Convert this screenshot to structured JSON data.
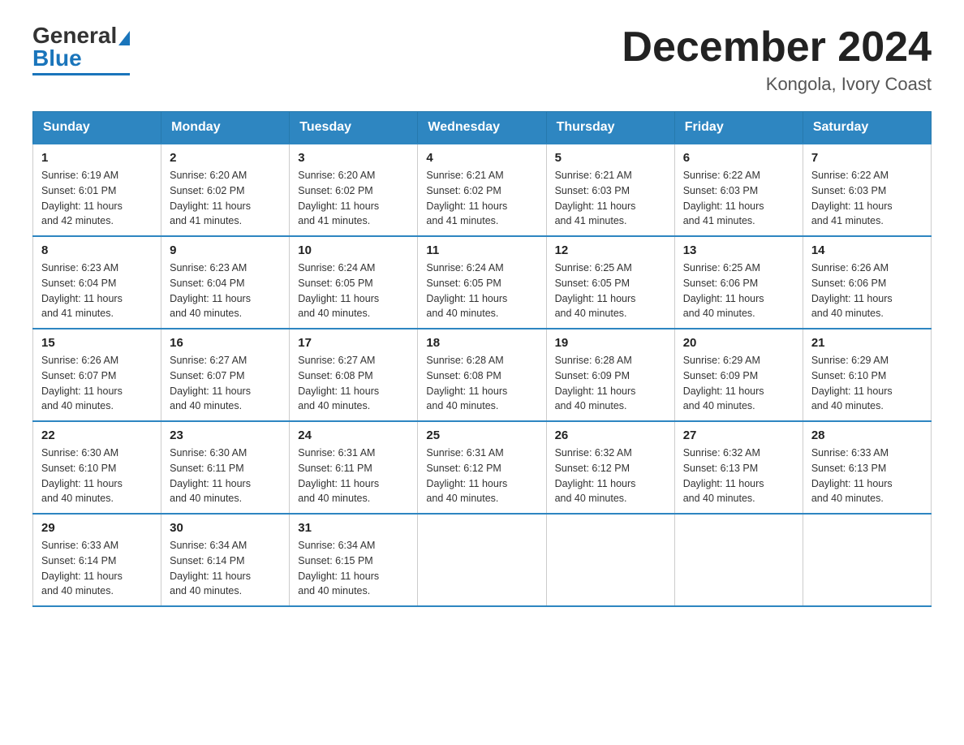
{
  "header": {
    "title": "December 2024",
    "location": "Kongola, Ivory Coast",
    "logo_general": "General",
    "logo_blue": "Blue"
  },
  "days_header": [
    "Sunday",
    "Monday",
    "Tuesday",
    "Wednesday",
    "Thursday",
    "Friday",
    "Saturday"
  ],
  "weeks": [
    [
      {
        "day": "1",
        "sunrise": "6:19 AM",
        "sunset": "6:01 PM",
        "daylight": "11 hours and 42 minutes."
      },
      {
        "day": "2",
        "sunrise": "6:20 AM",
        "sunset": "6:02 PM",
        "daylight": "11 hours and 41 minutes."
      },
      {
        "day": "3",
        "sunrise": "6:20 AM",
        "sunset": "6:02 PM",
        "daylight": "11 hours and 41 minutes."
      },
      {
        "day": "4",
        "sunrise": "6:21 AM",
        "sunset": "6:02 PM",
        "daylight": "11 hours and 41 minutes."
      },
      {
        "day": "5",
        "sunrise": "6:21 AM",
        "sunset": "6:03 PM",
        "daylight": "11 hours and 41 minutes."
      },
      {
        "day": "6",
        "sunrise": "6:22 AM",
        "sunset": "6:03 PM",
        "daylight": "11 hours and 41 minutes."
      },
      {
        "day": "7",
        "sunrise": "6:22 AM",
        "sunset": "6:03 PM",
        "daylight": "11 hours and 41 minutes."
      }
    ],
    [
      {
        "day": "8",
        "sunrise": "6:23 AM",
        "sunset": "6:04 PM",
        "daylight": "11 hours and 41 minutes."
      },
      {
        "day": "9",
        "sunrise": "6:23 AM",
        "sunset": "6:04 PM",
        "daylight": "11 hours and 40 minutes."
      },
      {
        "day": "10",
        "sunrise": "6:24 AM",
        "sunset": "6:05 PM",
        "daylight": "11 hours and 40 minutes."
      },
      {
        "day": "11",
        "sunrise": "6:24 AM",
        "sunset": "6:05 PM",
        "daylight": "11 hours and 40 minutes."
      },
      {
        "day": "12",
        "sunrise": "6:25 AM",
        "sunset": "6:05 PM",
        "daylight": "11 hours and 40 minutes."
      },
      {
        "day": "13",
        "sunrise": "6:25 AM",
        "sunset": "6:06 PM",
        "daylight": "11 hours and 40 minutes."
      },
      {
        "day": "14",
        "sunrise": "6:26 AM",
        "sunset": "6:06 PM",
        "daylight": "11 hours and 40 minutes."
      }
    ],
    [
      {
        "day": "15",
        "sunrise": "6:26 AM",
        "sunset": "6:07 PM",
        "daylight": "11 hours and 40 minutes."
      },
      {
        "day": "16",
        "sunrise": "6:27 AM",
        "sunset": "6:07 PM",
        "daylight": "11 hours and 40 minutes."
      },
      {
        "day": "17",
        "sunrise": "6:27 AM",
        "sunset": "6:08 PM",
        "daylight": "11 hours and 40 minutes."
      },
      {
        "day": "18",
        "sunrise": "6:28 AM",
        "sunset": "6:08 PM",
        "daylight": "11 hours and 40 minutes."
      },
      {
        "day": "19",
        "sunrise": "6:28 AM",
        "sunset": "6:09 PM",
        "daylight": "11 hours and 40 minutes."
      },
      {
        "day": "20",
        "sunrise": "6:29 AM",
        "sunset": "6:09 PM",
        "daylight": "11 hours and 40 minutes."
      },
      {
        "day": "21",
        "sunrise": "6:29 AM",
        "sunset": "6:10 PM",
        "daylight": "11 hours and 40 minutes."
      }
    ],
    [
      {
        "day": "22",
        "sunrise": "6:30 AM",
        "sunset": "6:10 PM",
        "daylight": "11 hours and 40 minutes."
      },
      {
        "day": "23",
        "sunrise": "6:30 AM",
        "sunset": "6:11 PM",
        "daylight": "11 hours and 40 minutes."
      },
      {
        "day": "24",
        "sunrise": "6:31 AM",
        "sunset": "6:11 PM",
        "daylight": "11 hours and 40 minutes."
      },
      {
        "day": "25",
        "sunrise": "6:31 AM",
        "sunset": "6:12 PM",
        "daylight": "11 hours and 40 minutes."
      },
      {
        "day": "26",
        "sunrise": "6:32 AM",
        "sunset": "6:12 PM",
        "daylight": "11 hours and 40 minutes."
      },
      {
        "day": "27",
        "sunrise": "6:32 AM",
        "sunset": "6:13 PM",
        "daylight": "11 hours and 40 minutes."
      },
      {
        "day": "28",
        "sunrise": "6:33 AM",
        "sunset": "6:13 PM",
        "daylight": "11 hours and 40 minutes."
      }
    ],
    [
      {
        "day": "29",
        "sunrise": "6:33 AM",
        "sunset": "6:14 PM",
        "daylight": "11 hours and 40 minutes."
      },
      {
        "day": "30",
        "sunrise": "6:34 AM",
        "sunset": "6:14 PM",
        "daylight": "11 hours and 40 minutes."
      },
      {
        "day": "31",
        "sunrise": "6:34 AM",
        "sunset": "6:15 PM",
        "daylight": "11 hours and 40 minutes."
      },
      null,
      null,
      null,
      null
    ]
  ],
  "labels": {
    "sunrise": "Sunrise:",
    "sunset": "Sunset:",
    "daylight": "Daylight:"
  }
}
